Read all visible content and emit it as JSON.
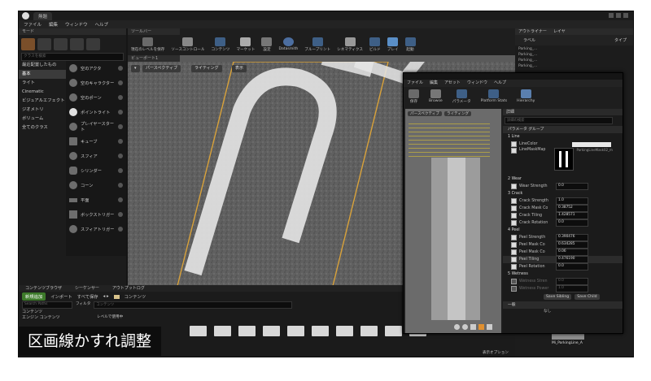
{
  "window": {
    "tab_title": "無題"
  },
  "menu": [
    "ファイル",
    "編集",
    "ウィンドウ",
    "ヘルプ"
  ],
  "modes": {
    "header": "モード",
    "search_placeholder": "クラスを検索"
  },
  "categories": [
    "最近配置したもの",
    "基本",
    "ライト",
    "Cinematic",
    "ビジュアルエフェクト",
    "ジオメトリ",
    "ボリューム",
    "全てのクラス"
  ],
  "selected_category": "基本",
  "placeables": [
    "空のアクタ",
    "空のキャラクター",
    "空のポーン",
    "ポイントライト",
    "プレイヤースタート",
    "キューブ",
    "スフィア",
    "シリンダー",
    "コーン",
    "平面",
    "ボックストリガー",
    "スフィアトリガー"
  ],
  "toolbar": {
    "header": "ツールバー",
    "items": [
      "現在のレベルを保存",
      "ソースコントロール",
      "コンテンツ",
      "マーケット",
      "設定",
      "Datasmith",
      "ブループリント",
      "シネマティクス",
      "ビルド",
      "プレイ",
      "起動"
    ]
  },
  "viewport": {
    "tab": "ビューポート1",
    "perspective": "パースペクティブ",
    "lighting": "ライティング",
    "show": "表示"
  },
  "outliner": {
    "tabs": [
      "アウトライナー",
      "レイヤ"
    ],
    "label_col": "ラベル",
    "type_col": "タイプ",
    "items": [
      "Parking_...",
      "Parking_...",
      "Parking_...",
      "Parking_..."
    ]
  },
  "mat": {
    "menu": [
      "ファイル",
      "編集",
      "アセット",
      "ウィンドウ",
      "ヘルプ"
    ],
    "tools": [
      "保存",
      "Browse",
      "パラメータ",
      "Platform Stats",
      "Hierarchy"
    ],
    "details_tab": "詳細",
    "search_placeholder": "詳細の検索",
    "param_group": "パラメータ グループ",
    "prev_perspective": "パースペクティブ",
    "prev_lighting": "ライティング",
    "groups": [
      {
        "name": "1 Line",
        "rows": [
          {
            "label": "LineColor",
            "value": ""
          },
          {
            "label": "LineMaskMap",
            "value": "ParkingLineMask02_m"
          }
        ]
      },
      {
        "name": "2 Wear",
        "rows": [
          {
            "label": "Wear Strength",
            "value": "0.0"
          }
        ]
      },
      {
        "name": "3 Crack",
        "rows": [
          {
            "label": "Crack Strength",
            "value": "1.0"
          },
          {
            "label": "Crack Mask Co",
            "value": "0.38752"
          },
          {
            "label": "Crack Tiling",
            "value": "1.428571"
          },
          {
            "label": "Crack Rotation",
            "value": "0.0"
          }
        ]
      },
      {
        "name": "4 Peel",
        "rows": [
          {
            "label": "Peel Strength",
            "value": "0.390476"
          },
          {
            "label": "Peel Mask Co",
            "value": "0.634285"
          },
          {
            "label": "Peel Mask Co",
            "value": "0.06"
          },
          {
            "label": "Peel Tiling",
            "value": "0.476190"
          },
          {
            "label": "Peel Rotation",
            "value": "0.0"
          }
        ]
      },
      {
        "name": "5 Wetness",
        "rows": [
          {
            "label": "Wetness Stren",
            "value": "0.0"
          },
          {
            "label": "Wetness Power",
            "value": "1.0"
          }
        ]
      }
    ],
    "save_sibling": "Save Sibling",
    "save_child": "Save Child",
    "general": "一般",
    "none": "なし",
    "bottom_asset": "Mi_ParkingLine_A"
  },
  "content": {
    "tabs": [
      "コンテンツブラウザ",
      "シーケンサー",
      "アウトプットログ"
    ],
    "add_new": "新規追加",
    "import": "インポート",
    "save_all": "すべて保存",
    "breadcrumb": "コンテンツ",
    "search_placeholder": "Search Paths",
    "filter": "フィルタ",
    "filter_placeholder": "コンテンツ",
    "tree_items": [
      "コンテンツ",
      "エンジン コンテンツ"
    ],
    "level_label": "レベルで使用中",
    "view_options": "表示オプション"
  },
  "caption": "区画線かすれ調整"
}
